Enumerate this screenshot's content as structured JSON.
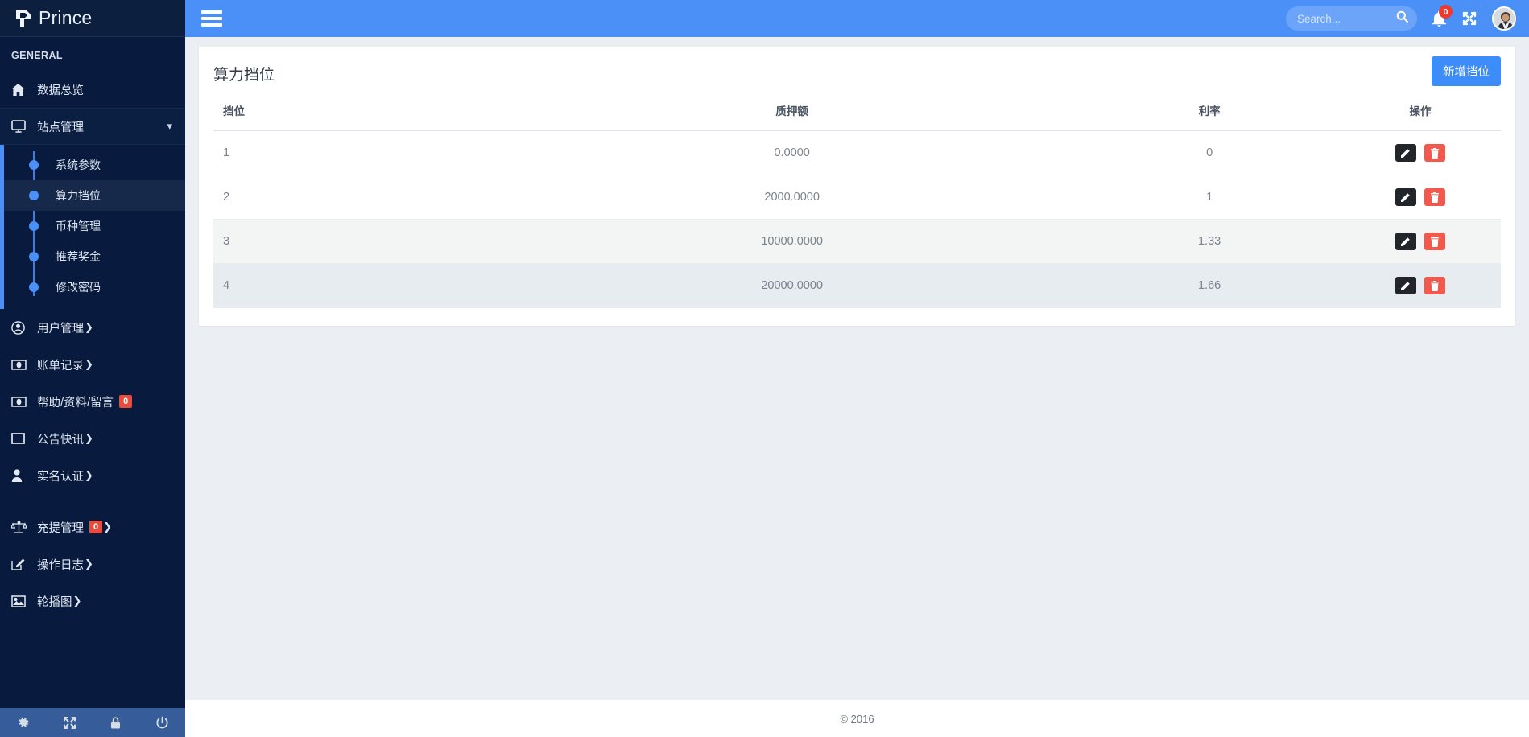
{
  "brand": {
    "name": "Prince",
    "logo_icon": "prince-p-logo"
  },
  "sidebar": {
    "section_label": "GENERAL",
    "items": [
      {
        "label": "数据总览",
        "icon": "home-icon",
        "badge": null,
        "caret": ""
      },
      {
        "label": "站点管理",
        "icon": "desktop-icon",
        "badge": null,
        "caret": "down"
      },
      {
        "label": "用户管理",
        "icon": "user-circle-icon",
        "badge": null,
        "caret": "right"
      },
      {
        "label": "账单记录",
        "icon": "money-bill-icon",
        "badge": null,
        "caret": "right"
      },
      {
        "label": "帮助/资料/留言",
        "icon": "money-bill-icon",
        "badge": "0",
        "caret": ""
      },
      {
        "label": "公告快讯",
        "icon": "window-icon",
        "badge": null,
        "caret": "right"
      },
      {
        "label": "实名认证",
        "icon": "person-icon",
        "badge": null,
        "caret": "right"
      },
      {
        "label": "充提管理",
        "icon": "balance-scale-icon",
        "badge": "0",
        "caret": "right"
      },
      {
        "label": "操作日志",
        "icon": "pencil-square-icon",
        "badge": null,
        "caret": "right"
      },
      {
        "label": "轮播图",
        "icon": "image-icon",
        "badge": null,
        "caret": "right"
      }
    ],
    "submenu": [
      {
        "label": "系统参数",
        "active": false
      },
      {
        "label": "算力挡位",
        "active": true
      },
      {
        "label": "币种管理",
        "active": false
      },
      {
        "label": "推荐奖金",
        "active": false
      },
      {
        "label": "修改密码",
        "active": false
      }
    ],
    "footer_icons": [
      "gear-icon",
      "expand-icon",
      "lock-icon",
      "power-icon"
    ]
  },
  "topbar": {
    "menu_toggle_icon": "hamburger-icon",
    "search": {
      "placeholder": "Search...",
      "value": "",
      "icon": "search-icon"
    },
    "notifications": {
      "icon": "bell-icon",
      "count": "0"
    },
    "fullscreen_icon": "expand-arrows-icon",
    "avatar_icon": "user-avatar"
  },
  "page": {
    "title": "算力挡位",
    "add_button": "新增挡位"
  },
  "table": {
    "columns": [
      "挡位",
      "质押额",
      "利率",
      "操作"
    ],
    "rows": [
      {
        "level": "1",
        "pledge": "0.0000",
        "rate": "0"
      },
      {
        "level": "2",
        "pledge": "2000.0000",
        "rate": "1"
      },
      {
        "level": "3",
        "pledge": "10000.0000",
        "rate": "1.33"
      },
      {
        "level": "4",
        "pledge": "20000.0000",
        "rate": "1.66"
      }
    ],
    "actions": {
      "edit_icon": "pencil-icon",
      "delete_icon": "trash-icon"
    }
  },
  "footer": {
    "copyright": "© 2016"
  },
  "colors": {
    "sidebar_bg": "#081b3e",
    "accent_blue": "#4a90f7",
    "active_submenu_bg": "#16294b",
    "badge_red": "#e74c3c",
    "delete_red": "#f2584b",
    "edit_dark": "#22252a",
    "page_bg": "#ebeef3"
  }
}
